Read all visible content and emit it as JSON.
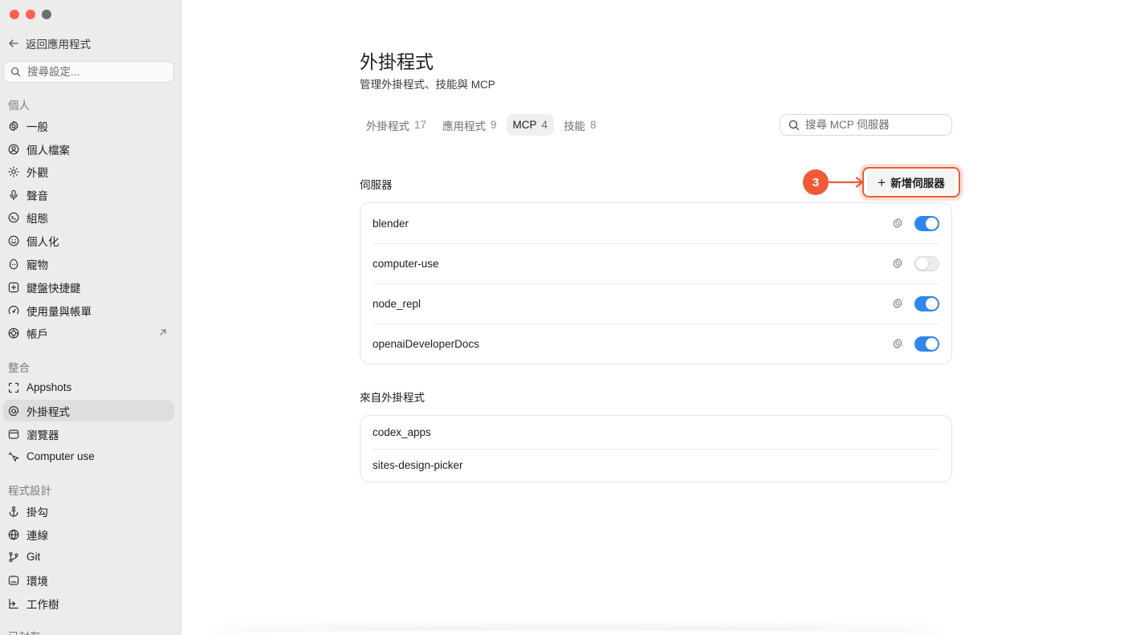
{
  "sidebar": {
    "back_label": "返回應用程式",
    "search_placeholder": "搜尋設定...",
    "sections": {
      "personal": "個人",
      "integrations": "整合",
      "coding": "程式設計",
      "archived": "已封存"
    },
    "items": [
      {
        "label": "一般",
        "icon": "gear-icon"
      },
      {
        "label": "個人檔案",
        "icon": "person-circle-icon"
      },
      {
        "label": "外觀",
        "icon": "sun-icon"
      },
      {
        "label": "聲音",
        "icon": "microphone-icon"
      },
      {
        "label": "組態",
        "icon": "config-icon"
      },
      {
        "label": "個人化",
        "icon": "smile-icon"
      },
      {
        "label": "寵物",
        "icon": "egg-icon"
      },
      {
        "label": "鍵盤快捷鍵",
        "icon": "keyboard-icon"
      },
      {
        "label": "使用量與帳單",
        "icon": "gauge-icon"
      },
      {
        "label": "帳戶",
        "icon": "account-icon"
      },
      {
        "label": "Appshots",
        "icon": "capture-icon"
      },
      {
        "label": "外掛程式",
        "icon": "at-icon"
      },
      {
        "label": "瀏覽器",
        "icon": "browser-icon"
      },
      {
        "label": "Computer use",
        "icon": "cursor-icon"
      },
      {
        "label": "掛勾",
        "icon": "anchor-icon"
      },
      {
        "label": "連線",
        "icon": "globe-icon"
      },
      {
        "label": "Git",
        "icon": "git-branch-icon"
      },
      {
        "label": "環境",
        "icon": "terminal-icon"
      },
      {
        "label": "工作樹",
        "icon": "worktree-icon"
      }
    ]
  },
  "main": {
    "title": "外掛程式",
    "subtitle": "管理外掛程式、技能與 MCP",
    "tabs": [
      {
        "label": "外掛程式",
        "count": "17"
      },
      {
        "label": "應用程式",
        "count": "9"
      },
      {
        "label": "MCP",
        "count": "4"
      },
      {
        "label": "技能",
        "count": "8"
      }
    ],
    "search_placeholder": "搜尋 MCP 伺服器",
    "servers_heading": "伺服器",
    "add_server_label": "新增伺服器",
    "annotation_number": "3",
    "servers": [
      {
        "name": "blender",
        "enabled": true
      },
      {
        "name": "computer-use",
        "enabled": false
      },
      {
        "name": "node_repl",
        "enabled": true
      },
      {
        "name": "openaiDeveloperDocs",
        "enabled": true
      }
    ],
    "from_plugins_heading": "來自外掛程式",
    "plugin_servers": [
      {
        "name": "codex_apps"
      },
      {
        "name": "sites-design-picker"
      }
    ]
  },
  "colors": {
    "accent_blue": "#2f86eb",
    "annotation_orange": "#f05a36",
    "sidebar_bg": "#ececea"
  }
}
